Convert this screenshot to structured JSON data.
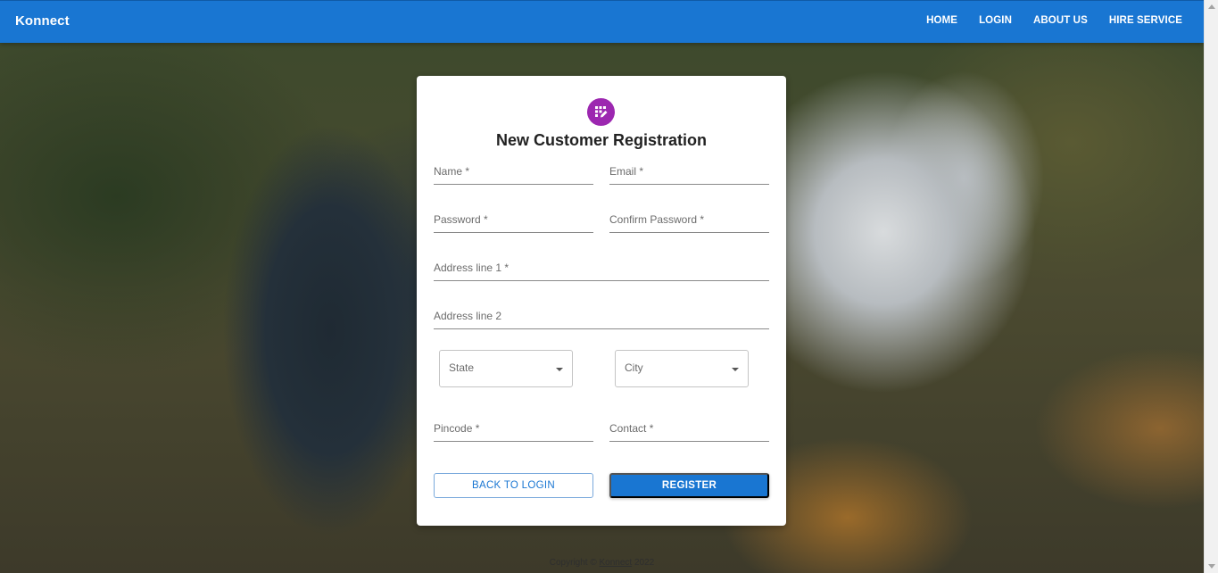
{
  "app": {
    "brand": "Konnect"
  },
  "nav": {
    "items": [
      {
        "label": "HOME"
      },
      {
        "label": "LOGIN"
      },
      {
        "label": "ABOUT US"
      },
      {
        "label": "HIRE SERVICE"
      }
    ]
  },
  "form": {
    "title": "New Customer Registration",
    "icon": "app-registration-icon",
    "fields": {
      "name": "Name *",
      "email": "Email *",
      "password": "Password *",
      "confirm_password": "Confirm Password *",
      "address1": "Address line 1 *",
      "address2": "Address line 2",
      "state": "State",
      "city": "City",
      "pincode": "Pincode *",
      "contact": "Contact *"
    },
    "buttons": {
      "back": "BACK TO LOGIN",
      "register": "REGISTER"
    }
  },
  "footer": {
    "prefix": "Copyright © ",
    "link": "Konnect",
    "year": " 2022"
  },
  "colors": {
    "primary": "#1976d2",
    "avatar": "#9c27b0"
  }
}
